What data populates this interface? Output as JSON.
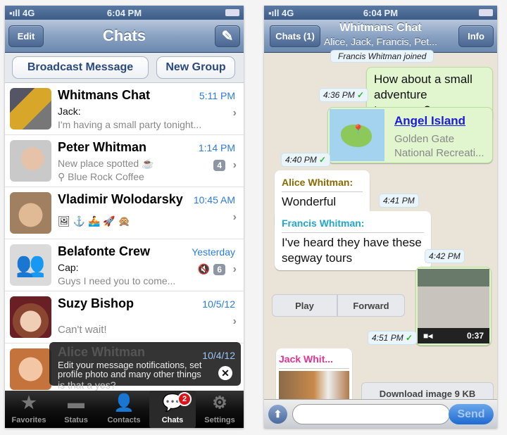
{
  "status": {
    "signal": "▪ıll 4G",
    "time": "6:04 PM"
  },
  "left": {
    "nav": {
      "edit": "Edit",
      "title": "Chats",
      "compose_icon": "compose-icon"
    },
    "strip": {
      "broadcast": "Broadcast Message",
      "new_group": "New Group"
    },
    "chats": [
      {
        "name": "Whitmans Chat",
        "time": "5:11 PM",
        "line1": "Jack:",
        "line2": "I'm having a small party tonight..."
      },
      {
        "name": "Peter Whitman",
        "time": "1:14 PM",
        "line1": "New place spotted ☕",
        "line2": "⚲ Blue Rock Coffee",
        "badge": "4"
      },
      {
        "name": "Vladimir Wolodarsky",
        "time": "10:45 AM",
        "line1": "🖼 ⚓ 🚣 🚀    🙊"
      },
      {
        "name": "Belafonte Crew",
        "time": "Yesterday",
        "line1": "Cap:",
        "line2": "Guys I need you to come...",
        "badge": "6"
      },
      {
        "name": "Suzy Bishop",
        "time": "10/5/12",
        "line2": "Can't wait!"
      },
      {
        "name": "Alice Whitman",
        "time": "10/4/12",
        "line2": "is that a yes?"
      }
    ],
    "tooltip": "Edit your message notifications, set profile photo and many other things",
    "tabs": [
      {
        "label": "Favorites",
        "icon": "★"
      },
      {
        "label": "Status",
        "icon": "▬"
      },
      {
        "label": "Contacts",
        "icon": "👤"
      },
      {
        "label": "Chats",
        "icon": "💬",
        "badge": "2"
      },
      {
        "label": "Settings",
        "icon": "⚙"
      }
    ]
  },
  "right": {
    "nav": {
      "back": "Chats (1)",
      "title": "Whitmans Chat",
      "subtitle": "Alice, Jack, Francis, Pet...",
      "info": "Info"
    },
    "system": "Francis Whitman joined",
    "msg1": {
      "text": "How about a small adventure tomorrow?",
      "time": "4:36 PM ✓"
    },
    "location": {
      "title": "Angel Island",
      "line1": "Golden Gate",
      "line2": "National Recreati...",
      "time": "4:40 PM ✓"
    },
    "msg3": {
      "sender": "Alice Whitman:",
      "text": "Wonderful idea!",
      "time": "4:41 PM",
      "color": "#8a6a00"
    },
    "msg4": {
      "sender": "Francis Whitman:",
      "text": "I've heard they have these segway tours",
      "time": "4:42 PM",
      "color": "#22a6c9"
    },
    "video": {
      "duration": "0:37",
      "time": "4:51 PM ✓",
      "play": "Play",
      "forward": "Forward"
    },
    "msg6": {
      "sender": "Jack Whit...",
      "color": "#e0338f",
      "download": "Download image 9 KB"
    },
    "input": {
      "placeholder": "",
      "send": "Send"
    }
  }
}
